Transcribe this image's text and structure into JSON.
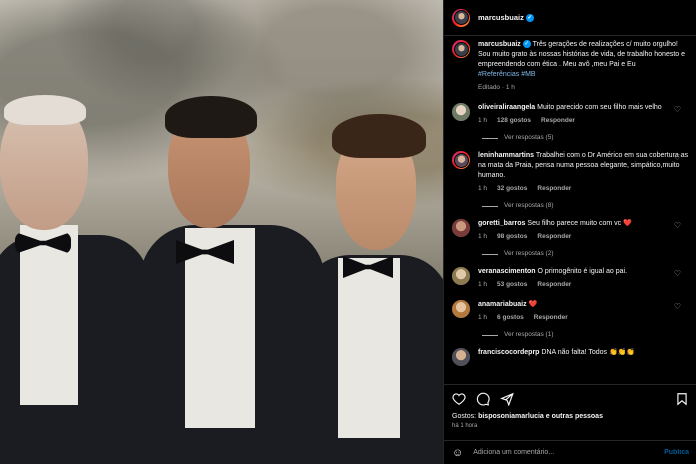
{
  "header": {
    "username": "marcusbuaiz"
  },
  "caption": {
    "username": "marcusbuaiz",
    "text": "Três gerações de realizações c/ muito orgulho! Sou muito grato às nossas histórias de vida, de trabalho honesto e empreendendo com ética . Meu avô ,meu Pai e Eu",
    "tags": "#Referências #MB",
    "edited": "Editado · 1 h"
  },
  "comments": [
    {
      "username": "oliveiraliraangela",
      "text": "Muito parecido com seu filho mais velho",
      "time": "1 h",
      "likes": "128 gostos",
      "reply": "Responder",
      "view_replies": "Ver respostas (5)"
    },
    {
      "username": "leninhammartins",
      "text": "Trabalhei com o Dr Américo em sua cobertura as na mata da Praia, pensa numa pessoa elegante, simpático,muito humano.",
      "time": "1 h",
      "likes": "32 gostos",
      "reply": "Responder",
      "view_replies": "Ver respostas (8)"
    },
    {
      "username": "goretti_barros",
      "text": "Seu filho parece muito com vc ❤️",
      "time": "1 h",
      "likes": "98 gostos",
      "reply": "Responder",
      "view_replies": "Ver respostas (2)"
    },
    {
      "username": "veranascimenton",
      "text": "O primogênito é igual ao pai.",
      "time": "1 h",
      "likes": "53 gostos",
      "reply": "Responder",
      "view_replies": ""
    },
    {
      "username": "anamariabuaiz",
      "text": "❤️",
      "time": "1 h",
      "likes": "6 gostos",
      "reply": "Responder",
      "view_replies": "Ver respostas (1)"
    },
    {
      "username": "franciscocordeprp",
      "text": "DNA não falta! Todos 👏👏👏",
      "time": "",
      "likes": "",
      "reply": "",
      "view_replies": ""
    }
  ],
  "footer": {
    "likes_prefix": "Gostos:",
    "likes_by": "bisposoniamarlucia e outras pessoas",
    "time": "há 1 hora",
    "comment_placeholder": "Adiciona um comentário...",
    "publish": "Publica"
  },
  "colors": {
    "accent": "#0095f6",
    "muted": "#a8a8a8",
    "like_red": "#ff3040"
  }
}
